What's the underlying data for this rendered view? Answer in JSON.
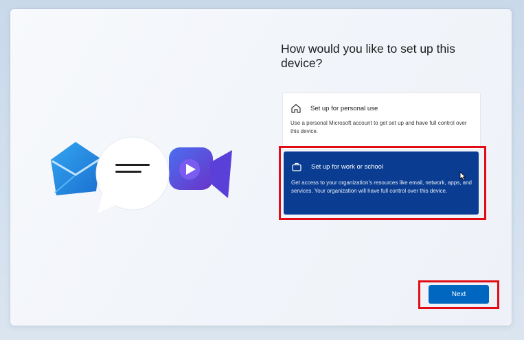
{
  "page": {
    "heading": "How would you like to set up this device?"
  },
  "options": [
    {
      "id": "personal",
      "title": "Set up for personal use",
      "description": "Use a personal Microsoft account to get set up and have full control over this device.",
      "icon": "home-icon",
      "selected": false
    },
    {
      "id": "work",
      "title": "Set up for work or school",
      "description": "Get access to your organization's resources like email, network, apps, and services. Your organization will have full control over this device.",
      "icon": "briefcase-icon",
      "selected": true
    }
  ],
  "buttons": {
    "next_label": "Next"
  },
  "illustration": {
    "icons": [
      "mail-icon",
      "chat-bubble-icon",
      "video-camera-icon"
    ]
  },
  "colors": {
    "selected_card_bg": "#0a3d91",
    "accent_button": "#0067c0",
    "highlight_annotation": "#e20c14",
    "window_bg": "#f4f6fa"
  }
}
